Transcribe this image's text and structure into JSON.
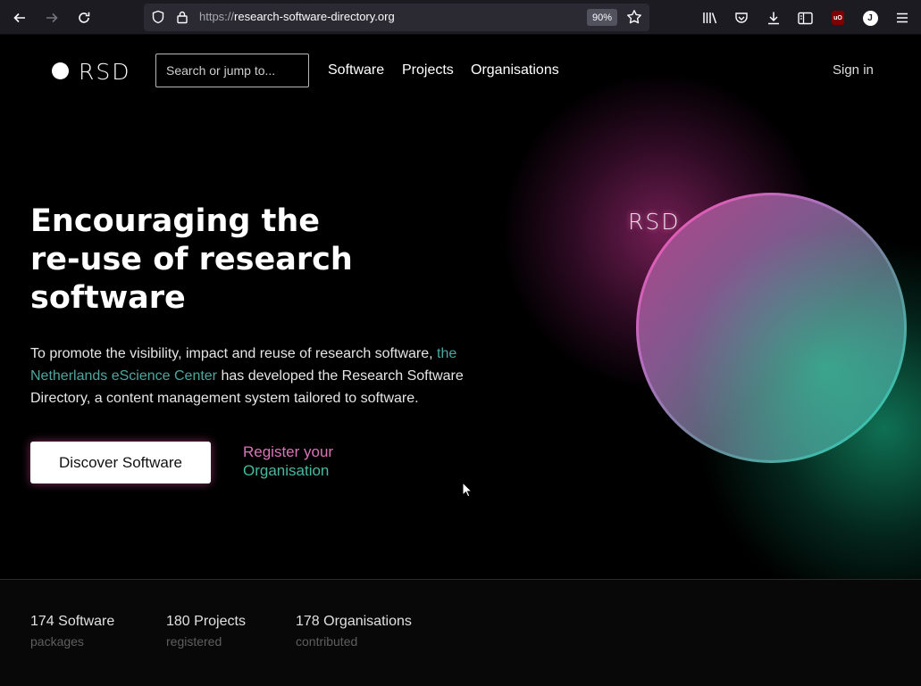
{
  "browser": {
    "url_proto": "https://",
    "url_host": "research-software-directory.org",
    "zoom": "90%",
    "account_initial": "J",
    "ublock_label": "uO"
  },
  "header": {
    "logo": "RSD",
    "search_placeholder": "Search or jump to...",
    "nav": [
      "Software",
      "Projects",
      "Organisations"
    ],
    "signin": "Sign in"
  },
  "hero": {
    "headline": [
      "Encouraging the",
      "re-use of research",
      "software"
    ],
    "intro_before": "To promote the visibility, impact and reuse of research software, ",
    "intro_link": "the Netherlands eScience Center",
    "intro_after": " has developed the Research Software Directory, a content management system tailored to software.",
    "cta": "Discover Software",
    "register_l1": "Register your",
    "register_l2": "Organisation",
    "orb_logo": "RSD"
  },
  "stats": [
    {
      "count": "174 Software",
      "label": "packages"
    },
    {
      "count": "180 Projects",
      "label": "registered"
    },
    {
      "count": "178 Organisations",
      "label": "contributed"
    }
  ],
  "colors": {
    "chrome_bg": "#1c1b22",
    "urlbar_bg": "#2b2a33",
    "page_bg": "#000000",
    "accent_pink": "#d876b6",
    "accent_teal": "#49b8a0",
    "link": "#4ea6a0"
  }
}
